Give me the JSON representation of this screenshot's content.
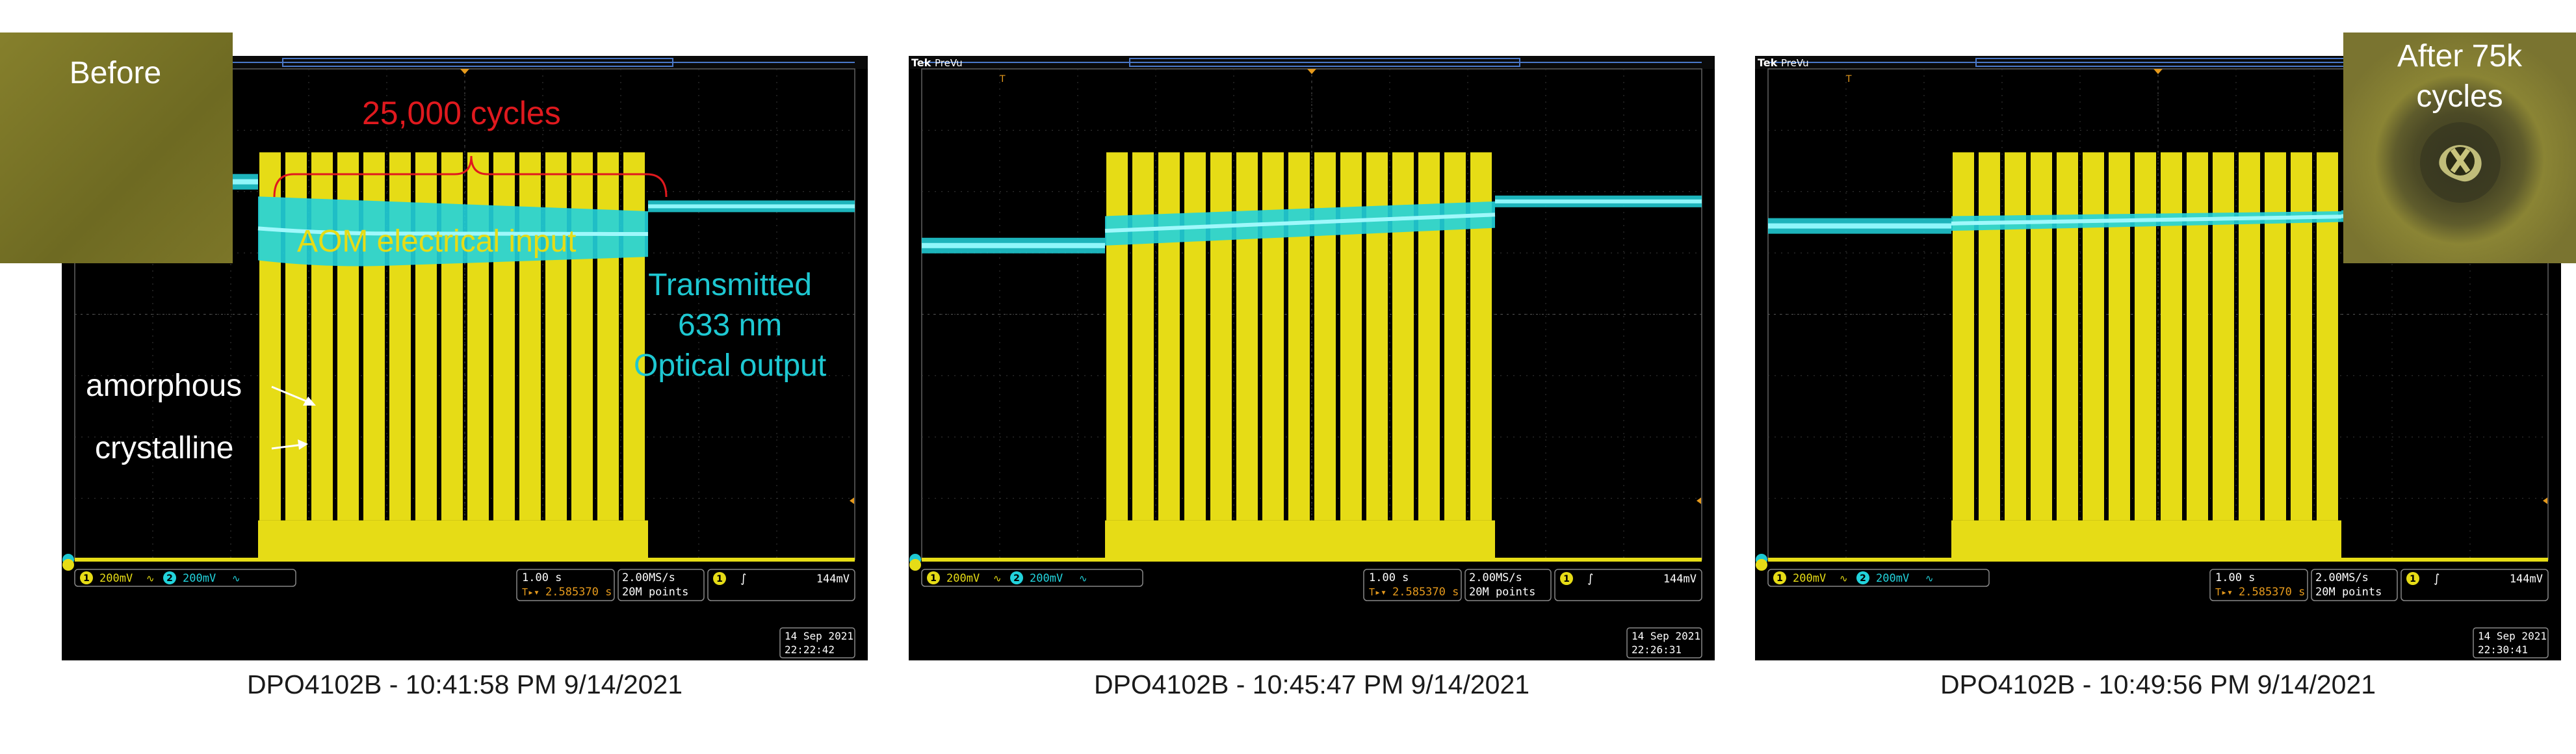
{
  "scopes": [
    {
      "brand": "",
      "menu": "",
      "caption": "DPO4102B - 10:41:58 PM   9/14/2021",
      "ch1_scale": "200mV",
      "ch2_scale": "200mV",
      "timebase": "1.00 s",
      "trig_pos": "2.585370 s",
      "sample_rate": "2.00MS/s",
      "record": "20M points",
      "trig_level": "144mV",
      "date": "14 Sep  2021",
      "time": "22:22:42"
    },
    {
      "brand": "Tek",
      "menu": "PreVu",
      "caption": "DPO4102B - 10:45:47 PM   9/14/2021",
      "ch1_scale": "200mV",
      "ch2_scale": "200mV",
      "timebase": "1.00 s",
      "trig_pos": "2.585370 s",
      "sample_rate": "2.00MS/s",
      "record": "20M points",
      "trig_level": "144mV",
      "date": "14 Sep  2021",
      "time": "22:26:31"
    },
    {
      "brand": "Tek",
      "menu": "PreVu",
      "caption": "DPO4102B - 10:49:56 PM   9/14/2021",
      "ch1_scale": "200mV",
      "ch2_scale": "200mV",
      "timebase": "1.00 s",
      "trig_pos": "2.585370 s",
      "sample_rate": "2.00MS/s",
      "record": "20M points",
      "trig_level": "144mV",
      "date": "14 Sep  2021",
      "time": "22:30:41"
    }
  ],
  "annotations": {
    "cycles": "25,000 cycles",
    "aom": "AOM electrical input",
    "transmitted": [
      "Transmitted",
      "633 nm",
      "Optical output"
    ],
    "amorphous": "amorphous",
    "crystalline": "crystalline"
  },
  "thumbnails": {
    "before": "Before",
    "after": [
      "After 75k",
      "cycles"
    ]
  },
  "colors": {
    "ch1": "#e6dc16",
    "ch2": "#22d3dc",
    "annotation_red": "#e0191e",
    "annotation_cyan": "#1ec8d2",
    "thumb_bg": "#7c7424"
  },
  "optical_level": [
    {
      "pre": 0.77,
      "start_top": 0.74,
      "start_bot": 0.61,
      "end_top": 0.71,
      "end_bot": 0.64,
      "post": 0.72
    },
    {
      "pre": 0.64,
      "start_top": 0.7,
      "start_bot": 0.64,
      "end_top": 0.73,
      "end_bot": 0.68,
      "post": 0.73
    },
    {
      "pre": 0.68,
      "start_top": 0.7,
      "start_bot": 0.67,
      "end_top": 0.71,
      "end_bot": 0.69,
      "post": 0.7
    }
  ]
}
